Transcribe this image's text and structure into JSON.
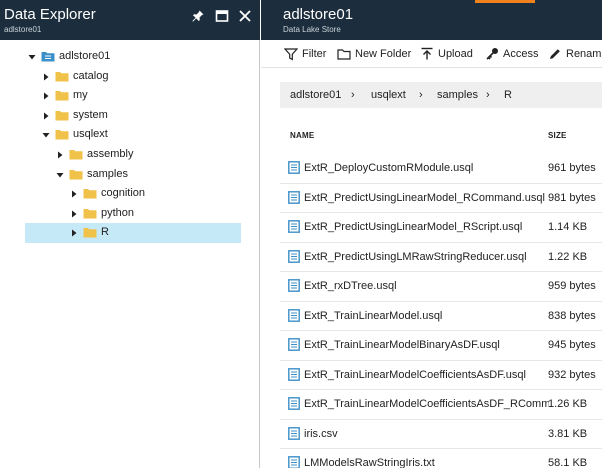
{
  "left_blade": {
    "title": "Data Explorer",
    "subtitle": "adlstore01",
    "header_icons": [
      "pin-icon",
      "maximize-icon",
      "close-icon"
    ],
    "tree": [
      {
        "label": "adlstore01",
        "depth": 0,
        "expanded": true,
        "icon": "storage-root-icon"
      },
      {
        "label": "catalog",
        "depth": 1,
        "expanded": false,
        "icon": "folder-icon"
      },
      {
        "label": "my",
        "depth": 1,
        "expanded": false,
        "icon": "folder-icon"
      },
      {
        "label": "system",
        "depth": 1,
        "expanded": false,
        "icon": "folder-icon"
      },
      {
        "label": "usqlext",
        "depth": 1,
        "expanded": true,
        "icon": "folder-icon"
      },
      {
        "label": "assembly",
        "depth": 2,
        "expanded": false,
        "icon": "folder-icon"
      },
      {
        "label": "samples",
        "depth": 2,
        "expanded": true,
        "icon": "folder-icon"
      },
      {
        "label": "cognition",
        "depth": 3,
        "expanded": false,
        "icon": "folder-icon"
      },
      {
        "label": "python",
        "depth": 3,
        "expanded": false,
        "icon": "folder-icon"
      },
      {
        "label": "R",
        "depth": 3,
        "expanded": false,
        "icon": "folder-icon",
        "selected": true
      }
    ]
  },
  "right_blade": {
    "title": "adlstore01",
    "subtitle": "Data Lake Store",
    "toolbar": [
      {
        "label": "Filter",
        "icon": "filter-icon"
      },
      {
        "label": "New Folder",
        "icon": "new-folder-icon"
      },
      {
        "label": "Upload",
        "icon": "upload-icon"
      },
      {
        "label": "Access",
        "icon": "key-icon"
      },
      {
        "label": "Rename",
        "icon": "pencil-icon"
      }
    ],
    "breadcrumb": [
      "adlstore01",
      "usqlext",
      "samples",
      "R"
    ],
    "columns": {
      "name": "NAME",
      "size": "SIZE"
    },
    "files": [
      {
        "name": "ExtR_DeployCustomRModule.usql",
        "size": "961 bytes"
      },
      {
        "name": "ExtR_PredictUsingLinearModel_RCommand.usql",
        "size": "981 bytes"
      },
      {
        "name": "ExtR_PredictUsingLinearModel_RScript.usql",
        "size": "1.14 KB"
      },
      {
        "name": "ExtR_PredictUsingLMRawStringReducer.usql",
        "size": "1.22 KB"
      },
      {
        "name": "ExtR_rxDTree.usql",
        "size": "959 bytes"
      },
      {
        "name": "ExtR_TrainLinearModel.usql",
        "size": "838 bytes"
      },
      {
        "name": "ExtR_TrainLinearModelBinaryAsDF.usql",
        "size": "945 bytes"
      },
      {
        "name": "ExtR_TrainLinearModelCoefficientsAsDF.usql",
        "size": "932 bytes"
      },
      {
        "name": "ExtR_TrainLinearModelCoefficientsAsDF_RComman...",
        "size": "1.26 KB"
      },
      {
        "name": "iris.csv",
        "size": "3.81 KB"
      },
      {
        "name": "LMModelsRawStringIris.txt",
        "size": "58.1 KB"
      }
    ]
  },
  "colors": {
    "header_bg": "#1c2e3d",
    "accent": "#f0821e",
    "selection": "#c6e9f7",
    "folder": "#f0c24a",
    "file_icon": "#3c8fc8"
  }
}
